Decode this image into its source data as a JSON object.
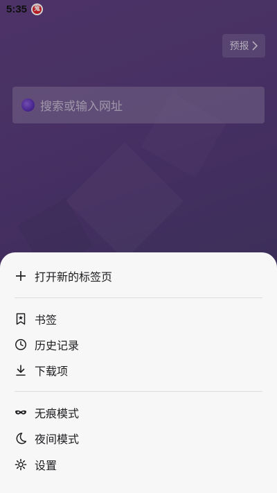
{
  "status_bar": {
    "time": "5:35",
    "app_icon_glyph": "鬼"
  },
  "forecast_button": {
    "label": "预报"
  },
  "search": {
    "placeholder": "搜索或输入网址"
  },
  "menu": {
    "groups": [
      [
        {
          "label": "打开新的标签页",
          "icon": "plus-icon"
        }
      ],
      [
        {
          "label": "书签",
          "icon": "bookmark-star-icon"
        },
        {
          "label": "历史记录",
          "icon": "clock-icon"
        },
        {
          "label": "下载项",
          "icon": "download-icon"
        }
      ],
      [
        {
          "label": "无痕模式",
          "icon": "incognito-mask-icon"
        },
        {
          "label": "夜间模式",
          "icon": "moon-icon"
        },
        {
          "label": "设置",
          "icon": "gear-icon"
        }
      ]
    ]
  },
  "colors": {
    "background_top": "#5e3f7e",
    "background_bottom": "#403a64",
    "sheet_background": "#f7f7f8",
    "text_primary": "#1d1d1f",
    "status_icon_red": "#d9232a"
  }
}
